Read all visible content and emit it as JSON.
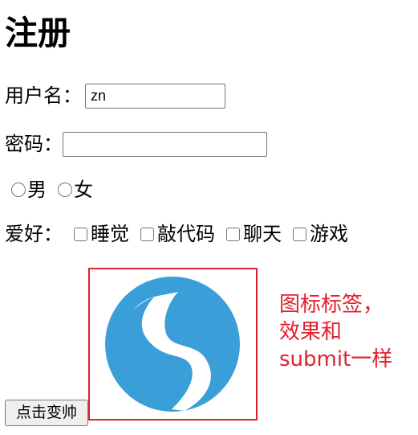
{
  "page": {
    "title": "注册"
  },
  "form": {
    "username_label": "用户名：",
    "username_value": "zn",
    "password_label": "密码：",
    "password_value": "",
    "gender_options": [
      "男",
      "女"
    ],
    "hobby_label": "爱好：",
    "hobbies": [
      "睡觉",
      "敲代码",
      "聊天",
      "游戏"
    ],
    "submit_label": "点击变帅"
  },
  "annotation": {
    "line1": "图标标签，",
    "line2": "效果和",
    "line3": "submit一样"
  },
  "colors": {
    "annotation": "#e0212e",
    "logo": "#3a9fd9"
  },
  "icons": {
    "image_submit": "swirl-logo-icon"
  }
}
